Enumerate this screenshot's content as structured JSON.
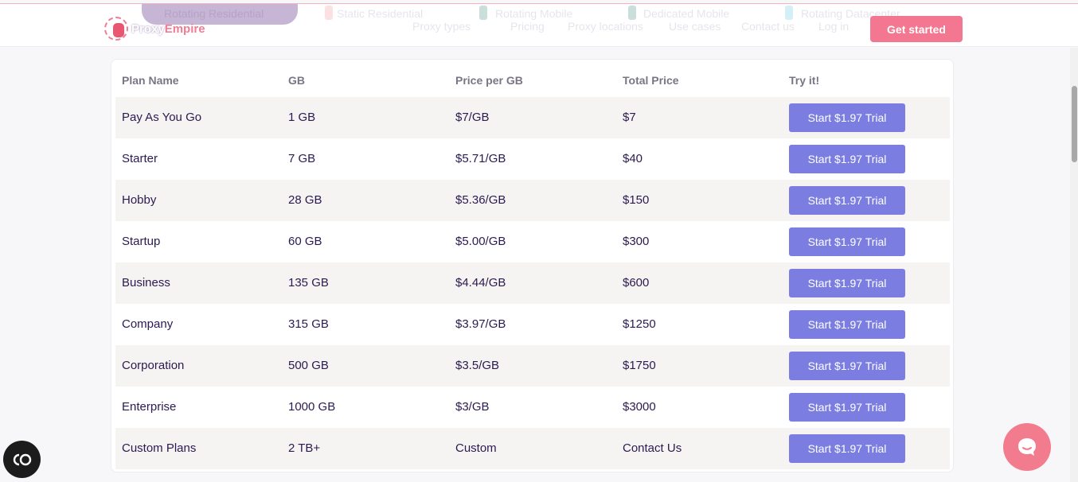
{
  "header": {
    "brand": {
      "part1": "Proxy",
      "part2": "Empire"
    },
    "ghost_tabs": [
      "Rotating Residential",
      "Static Residential",
      "Rotating Mobile",
      "Dedicated Mobile",
      "Rotating Datacenter"
    ],
    "ghost_nav": [
      "Proxy types",
      "Pricing",
      "Proxy locations",
      "Use cases",
      "Contact us",
      "Log in"
    ],
    "cta_label": "Get started"
  },
  "table": {
    "columns": [
      "Plan Name",
      "GB",
      "Price per GB",
      "Total Price",
      "Try it!"
    ],
    "rows": [
      {
        "plan": "Pay As You Go",
        "gb": "1 GB",
        "per_gb": "$7/GB",
        "total": "$7",
        "button": "Start $1.97 Trial"
      },
      {
        "plan": "Starter",
        "gb": "7 GB",
        "per_gb": "$5.71/GB",
        "total": "$40",
        "button": "Start $1.97 Trial"
      },
      {
        "plan": "Hobby",
        "gb": "28 GB",
        "per_gb": "$5.36/GB",
        "total": "$150",
        "button": "Start $1.97 Trial"
      },
      {
        "plan": "Startup",
        "gb": "60 GB",
        "per_gb": "$5.00/GB",
        "total": "$300",
        "button": "Start $1.97 Trial"
      },
      {
        "plan": "Business",
        "gb": "135 GB",
        "per_gb": "$4.44/GB",
        "total": "$600",
        "button": "Start $1.97 Trial"
      },
      {
        "plan": "Company",
        "gb": "315 GB",
        "per_gb": "$3.97/GB",
        "total": "$1250",
        "button": "Start $1.97 Trial"
      },
      {
        "plan": "Corporation",
        "gb": "500 GB",
        "per_gb": "$3.5/GB",
        "total": "$1750",
        "button": "Start $1.97 Trial"
      },
      {
        "plan": "Enterprise",
        "gb": "1000 GB",
        "per_gb": "$3/GB",
        "total": "$3000",
        "button": "Start $1.97 Trial"
      },
      {
        "plan": "Custom Plans",
        "gb": "2 TB+",
        "per_gb": "Custom",
        "total": "Contact Us",
        "button": "Start $1.97 Trial"
      }
    ]
  },
  "colors": {
    "accent_pink": "#f37790",
    "trial_button": "#7b7ee0",
    "text_dark": "#2b1a4f",
    "row_alt": "#f5f4f2"
  },
  "icons": {
    "accessibility": "accessibility-icon",
    "chat": "chat-bubble-icon"
  }
}
